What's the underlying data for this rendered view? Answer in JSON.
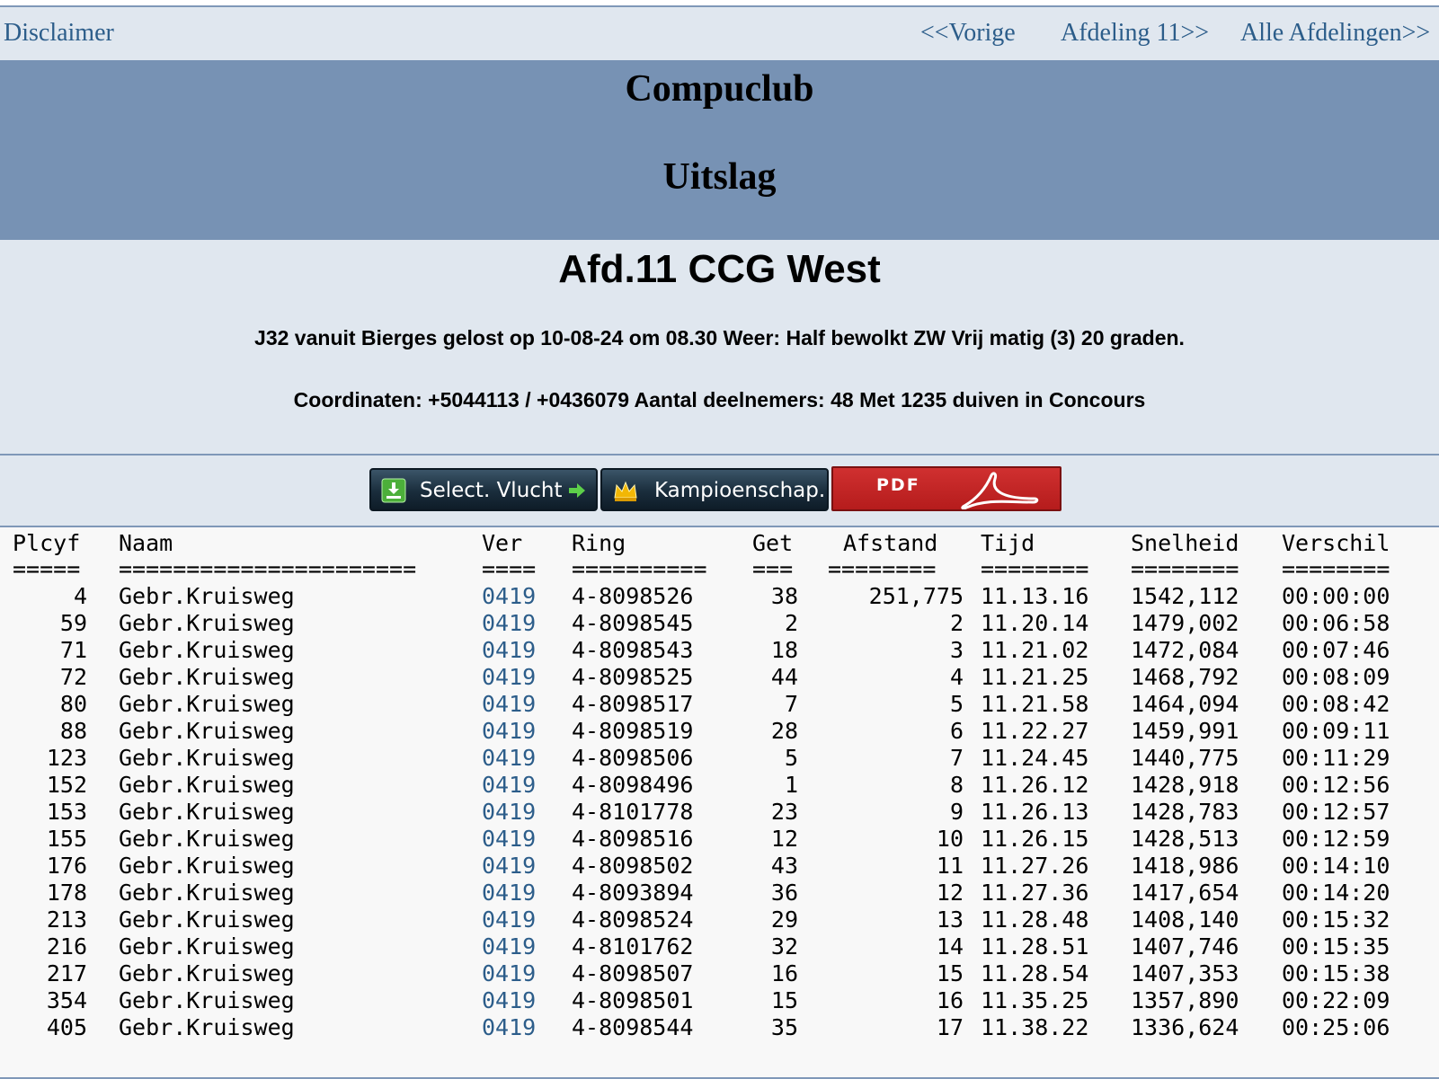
{
  "nav": {
    "disclaimer": "Disclaimer",
    "prev": "<<Vorige",
    "next": "Afdeling 11>>",
    "all": "Alle Afdelingen>>"
  },
  "banner": {
    "title": "Compuclub",
    "subtitle": "Uitslag"
  },
  "info": {
    "heading": "Afd.11 CCG West",
    "line1": "J32 vanuit Bierges gelost op 10-08-24 om 08.30 Weer: Half bewolkt ZW Vrij matig (3) 20 graden.",
    "line2": "Coordinaten: +5044113 / +0436079 Aantal deelnemers: 48 Met 1235 duiven in Concours"
  },
  "buttons": {
    "select_flight": "Select. Vlucht",
    "championship": "Kampioenschap.",
    "pdf": "PDF",
    "select_icon": "download-arrow-icon",
    "championship_icon": "crown-icon",
    "pdf_icon": "acrobat-icon"
  },
  "colors": {
    "link": "#2c5d8a",
    "banner": "#7792b4",
    "panel": "#e0e7ef",
    "pdf_red": "#c62626"
  },
  "table": {
    "headers": [
      "Plcyf",
      "Naam",
      "Ver",
      "Ring",
      "Get",
      "Afstand",
      "Tijd",
      "Snelheid",
      "Verschil"
    ],
    "separators": [
      "=====",
      "======================",
      "====",
      "==========",
      "===",
      "========",
      "========",
      "========",
      "========"
    ],
    "rows": [
      [
        "4",
        "Gebr.Kruisweg",
        "0419",
        "4-8098526",
        "38",
        "251,775",
        "11.13.16",
        "1542,112",
        "00:00:00"
      ],
      [
        "59",
        "Gebr.Kruisweg",
        "0419",
        "4-8098545",
        "2",
        "2",
        "11.20.14",
        "1479,002",
        "00:06:58"
      ],
      [
        "71",
        "Gebr.Kruisweg",
        "0419",
        "4-8098543",
        "18",
        "3",
        "11.21.02",
        "1472,084",
        "00:07:46"
      ],
      [
        "72",
        "Gebr.Kruisweg",
        "0419",
        "4-8098525",
        "44",
        "4",
        "11.21.25",
        "1468,792",
        "00:08:09"
      ],
      [
        "80",
        "Gebr.Kruisweg",
        "0419",
        "4-8098517",
        "7",
        "5",
        "11.21.58",
        "1464,094",
        "00:08:42"
      ],
      [
        "88",
        "Gebr.Kruisweg",
        "0419",
        "4-8098519",
        "28",
        "6",
        "11.22.27",
        "1459,991",
        "00:09:11"
      ],
      [
        "123",
        "Gebr.Kruisweg",
        "0419",
        "4-8098506",
        "5",
        "7",
        "11.24.45",
        "1440,775",
        "00:11:29"
      ],
      [
        "152",
        "Gebr.Kruisweg",
        "0419",
        "4-8098496",
        "1",
        "8",
        "11.26.12",
        "1428,918",
        "00:12:56"
      ],
      [
        "153",
        "Gebr.Kruisweg",
        "0419",
        "4-8101778",
        "23",
        "9",
        "11.26.13",
        "1428,783",
        "00:12:57"
      ],
      [
        "155",
        "Gebr.Kruisweg",
        "0419",
        "4-8098516",
        "12",
        "10",
        "11.26.15",
        "1428,513",
        "00:12:59"
      ],
      [
        "176",
        "Gebr.Kruisweg",
        "0419",
        "4-8098502",
        "43",
        "11",
        "11.27.26",
        "1418,986",
        "00:14:10"
      ],
      [
        "178",
        "Gebr.Kruisweg",
        "0419",
        "4-8093894",
        "36",
        "12",
        "11.27.36",
        "1417,654",
        "00:14:20"
      ],
      [
        "213",
        "Gebr.Kruisweg",
        "0419",
        "4-8098524",
        "29",
        "13",
        "11.28.48",
        "1408,140",
        "00:15:32"
      ],
      [
        "216",
        "Gebr.Kruisweg",
        "0419",
        "4-8101762",
        "32",
        "14",
        "11.28.51",
        "1407,746",
        "00:15:35"
      ],
      [
        "217",
        "Gebr.Kruisweg",
        "0419",
        "4-8098507",
        "16",
        "15",
        "11.28.54",
        "1407,353",
        "00:15:38"
      ],
      [
        "354",
        "Gebr.Kruisweg",
        "0419",
        "4-8098501",
        "15",
        "16",
        "11.35.25",
        "1357,890",
        "00:22:09"
      ],
      [
        "405",
        "Gebr.Kruisweg",
        "0419",
        "4-8098544",
        "35",
        "17",
        "11.38.22",
        "1336,624",
        "00:25:06"
      ]
    ]
  }
}
